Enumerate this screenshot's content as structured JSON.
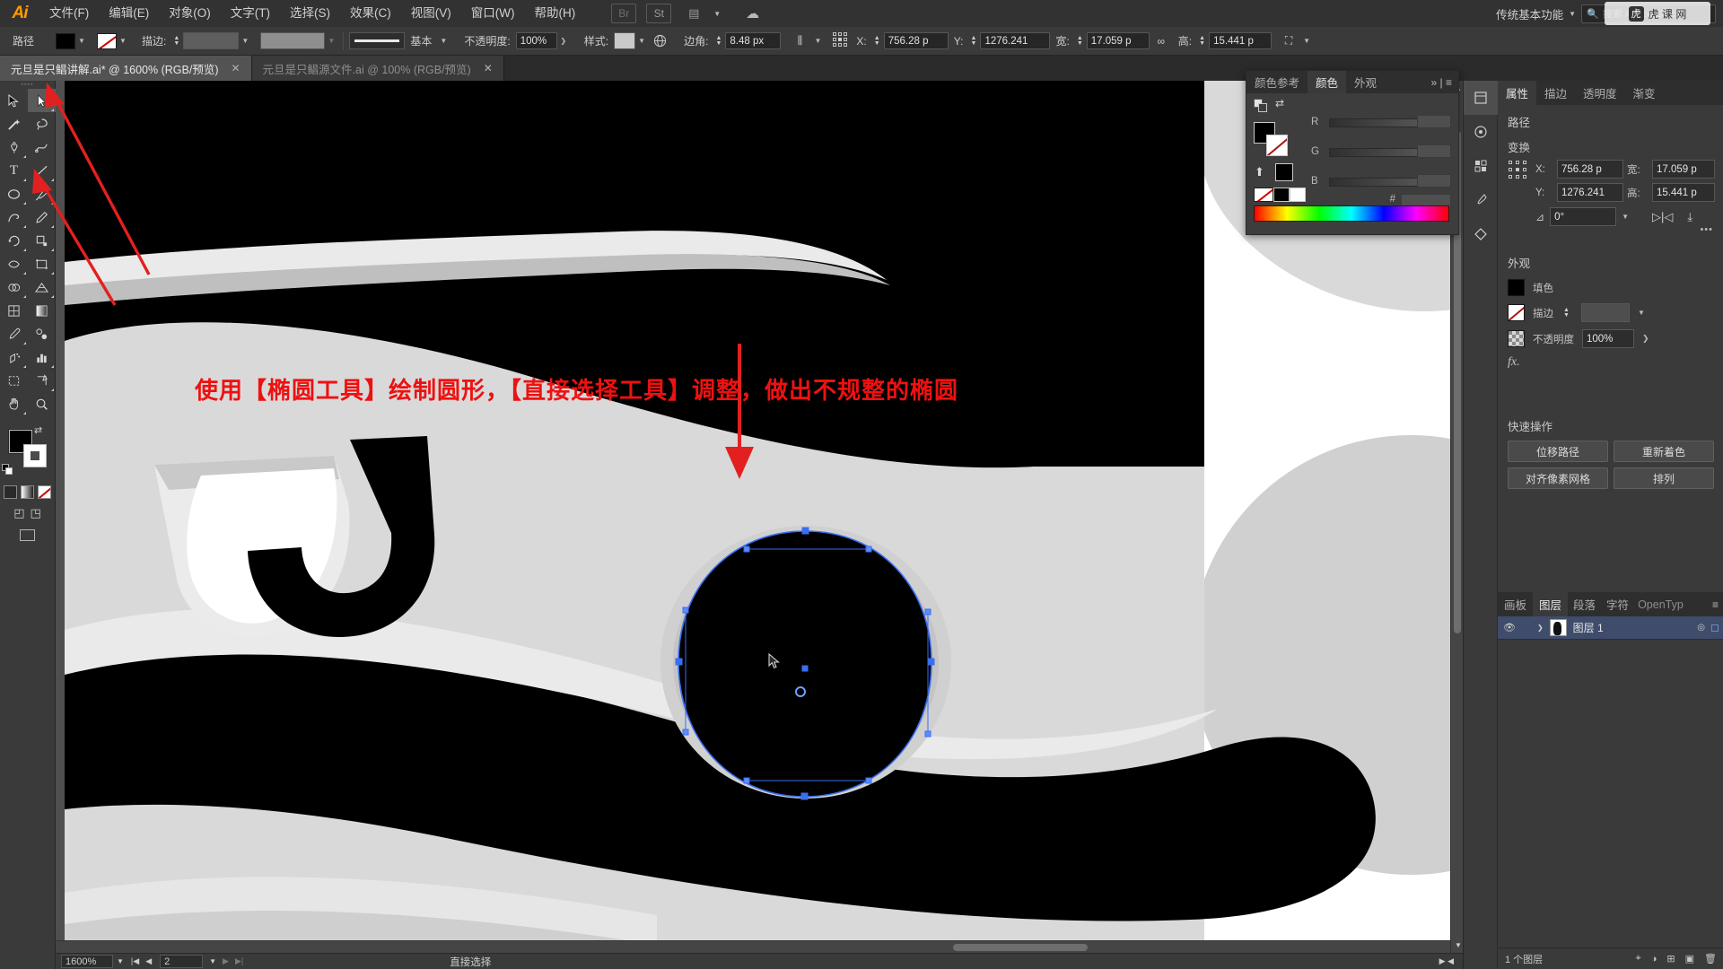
{
  "app": {
    "name": "Adobe Illustrator",
    "logo": "Ai",
    "workspace": "传统基本功能",
    "search_placeholder": "搜索 Adobe Stock"
  },
  "menubar": {
    "items": [
      {
        "label": "文件(F)",
        "name": "menu-file"
      },
      {
        "label": "编辑(E)",
        "name": "menu-edit"
      },
      {
        "label": "对象(O)",
        "name": "menu-object"
      },
      {
        "label": "文字(T)",
        "name": "menu-type"
      },
      {
        "label": "选择(S)",
        "name": "menu-select"
      },
      {
        "label": "效果(C)",
        "name": "menu-effect"
      },
      {
        "label": "视图(V)",
        "name": "menu-view"
      },
      {
        "label": "窗口(W)",
        "name": "menu-window"
      },
      {
        "label": "帮助(H)",
        "name": "menu-help"
      }
    ],
    "right_icons": [
      "Br",
      "St",
      "arrange-docs"
    ]
  },
  "controlbar": {
    "object_label": "路径",
    "fill_color": "#000000",
    "stroke_label": "描边:",
    "stroke_swatch": "#5e5e5e",
    "stroke_weight": "",
    "stroke_profile_label": "基本",
    "opacity_label": "不透明度:",
    "opacity_value": "100%",
    "style_label": "样式:",
    "corner_label": "边角:",
    "corner_value": "8.48 px",
    "x_label": "X:",
    "x_value": "756.28 p",
    "y_label": "Y:",
    "y_value": "1276.241",
    "w_label": "宽:",
    "w_value": "17.059 p",
    "h_label": "高:",
    "h_value": "15.441 p"
  },
  "tabs": [
    {
      "title": "元旦是只鲳讲解.ai* @ 1600% (RGB/预览)",
      "active": true,
      "close": "✕"
    },
    {
      "title": "元旦是只鲳源文件.ai @ 100% (RGB/预览)",
      "active": false,
      "close": "✕"
    }
  ],
  "toolbar": {
    "tools": [
      {
        "name": "selection-tool",
        "glyph": "arrow",
        "selected": false
      },
      {
        "name": "direct-selection-tool",
        "glyph": "arrow-white",
        "selected": true
      },
      {
        "name": "magic-wand-tool",
        "glyph": "wand",
        "selected": false
      },
      {
        "name": "lasso-tool",
        "glyph": "lasso",
        "selected": false
      },
      {
        "name": "pen-tool",
        "glyph": "pen",
        "selected": false
      },
      {
        "name": "curvature-tool",
        "glyph": "curvature",
        "selected": false
      },
      {
        "name": "type-tool",
        "glyph": "T",
        "selected": false
      },
      {
        "name": "line-segment-tool",
        "glyph": "line",
        "selected": false
      },
      {
        "name": "ellipse-tool",
        "glyph": "ellipse",
        "selected": false
      },
      {
        "name": "paintbrush-tool",
        "glyph": "brush",
        "selected": false
      },
      {
        "name": "shaper-tool",
        "glyph": "shaper",
        "selected": false
      },
      {
        "name": "pencil-tool",
        "glyph": "pencil",
        "selected": false
      },
      {
        "name": "rotate-tool",
        "glyph": "rotate",
        "selected": false
      },
      {
        "name": "scale-tool",
        "glyph": "scale",
        "selected": false
      },
      {
        "name": "width-tool",
        "glyph": "width",
        "selected": false
      },
      {
        "name": "free-transform-tool",
        "glyph": "transform",
        "selected": false
      },
      {
        "name": "shape-builder-tool",
        "glyph": "shapebuilder",
        "selected": false
      },
      {
        "name": "perspective-grid-tool",
        "glyph": "perspective",
        "selected": false
      },
      {
        "name": "mesh-tool",
        "glyph": "mesh",
        "selected": false
      },
      {
        "name": "gradient-tool",
        "glyph": "gradient",
        "selected": false
      },
      {
        "name": "eyedropper-tool",
        "glyph": "eyedropper",
        "selected": false
      },
      {
        "name": "blend-tool",
        "glyph": "blend",
        "selected": false
      },
      {
        "name": "symbol-sprayer-tool",
        "glyph": "symbol",
        "selected": false
      },
      {
        "name": "column-graph-tool",
        "glyph": "graph",
        "selected": false
      },
      {
        "name": "artboard-tool",
        "glyph": "artboard",
        "selected": false
      },
      {
        "name": "slice-tool",
        "glyph": "slice",
        "selected": false
      },
      {
        "name": "hand-tool",
        "glyph": "hand",
        "selected": false
      },
      {
        "name": "zoom-tool",
        "glyph": "zoom",
        "selected": false
      }
    ],
    "fill_color": "#000000",
    "stroke_color": "#ffffff"
  },
  "canvas": {
    "annotation_text": "使用【椭圆工具】绘制圆形，【直接选择工具】调整，做出不规整的椭圆",
    "annotation_color": "#ee1111",
    "art_background": "#000000",
    "art_light": "#d9d9d9",
    "art_mid": "#bcbcbc",
    "art_white": "#ffffff",
    "selection_color": "#3a6ef0"
  },
  "statusbar": {
    "zoom": "1600%",
    "page": "2",
    "tool_name": "直接选择"
  },
  "color_panel": {
    "tabs": [
      {
        "label": "颜色参考",
        "active": false
      },
      {
        "label": "颜色",
        "active": true
      },
      {
        "label": "外观",
        "active": false
      }
    ],
    "channels": [
      "R",
      "G",
      "B"
    ],
    "hex_label": "#",
    "fill": "#000000",
    "stroke": "none"
  },
  "properties": {
    "tabs": [
      {
        "label": "属性",
        "active": true
      },
      {
        "label": "描边",
        "active": false
      },
      {
        "label": "透明度",
        "active": false
      },
      {
        "label": "渐变",
        "active": false
      }
    ],
    "object_type": "路径",
    "transform": {
      "title": "变换",
      "x_label": "X:",
      "x_value": "756.28 p",
      "y_label": "Y:",
      "y_value": "1276.241",
      "w_label": "宽:",
      "w_value": "17.059 p",
      "h_label": "高:",
      "h_value": "15.441 p",
      "angle_value": "0°",
      "more_options": "•••"
    },
    "appearance": {
      "title": "外观",
      "fill_label": "填色",
      "fill_color": "#000000",
      "stroke_label": "描边",
      "stroke_value": "",
      "opacity_label": "不透明度",
      "opacity_value": "100%",
      "fx_label": "fx."
    },
    "quick_actions": {
      "title": "快速操作",
      "buttons": [
        "位移路径",
        "重新着色",
        "对齐像素网格",
        "排列"
      ]
    }
  },
  "layers_panel": {
    "tabs": [
      {
        "label": "画板",
        "active": false
      },
      {
        "label": "图层",
        "active": true
      },
      {
        "label": "段落",
        "active": false
      },
      {
        "label": "字符",
        "active": false
      },
      {
        "label": "OpenTyp",
        "active": false
      }
    ],
    "rows": [
      {
        "name": "图层 1",
        "visible": true,
        "selected": true
      }
    ],
    "footer": "1 个图层"
  }
}
